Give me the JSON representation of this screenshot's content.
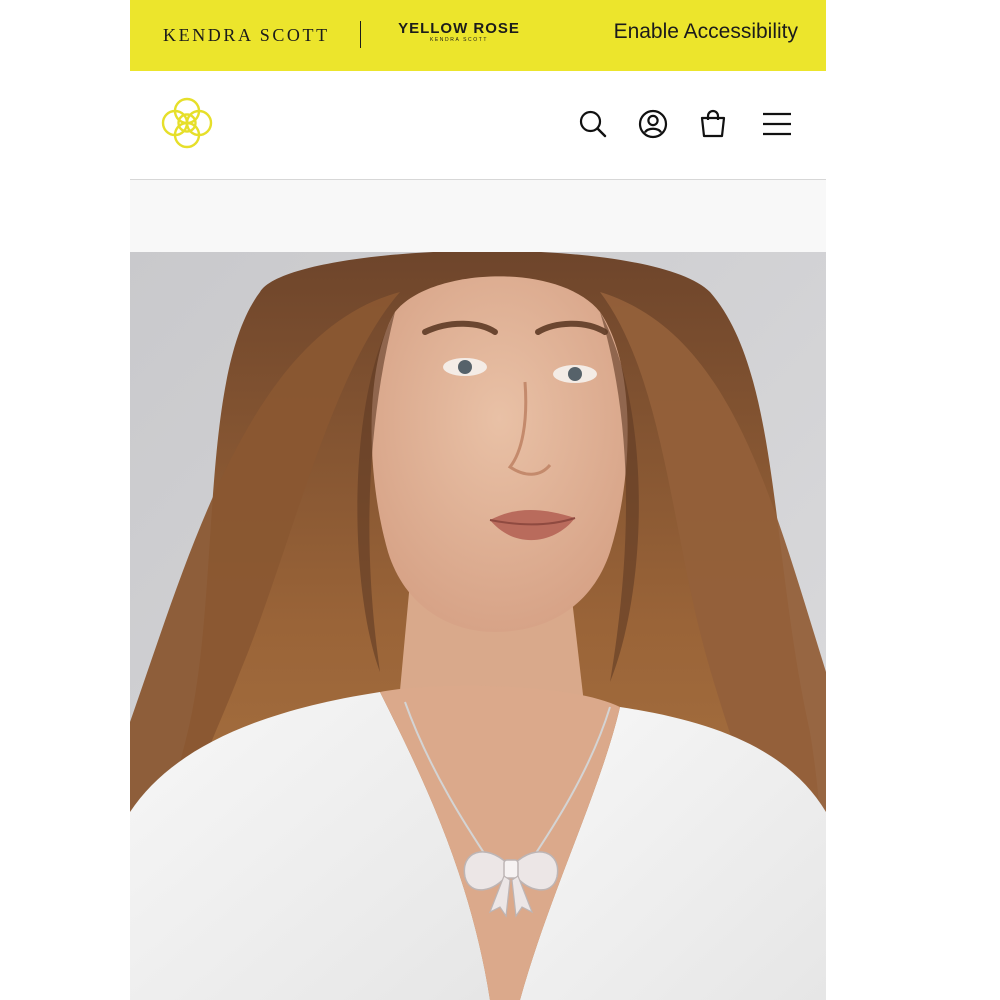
{
  "brand_bar": {
    "kendra_scott": "KENDRA SCOTT",
    "yellow_rose": "YELLOW ROSE",
    "yellow_rose_sub": "KENDRA SCOTT",
    "accessibility": "Enable Accessibility"
  },
  "header": {
    "logo": "kendra-scott-flower-logo",
    "icons": [
      "search-icon",
      "account-icon",
      "shopping-bag-icon",
      "hamburger-menu-icon"
    ]
  },
  "promo_strip": {},
  "hero": {
    "image": "model-wearing-bow-pendant-necklace"
  },
  "colors": {
    "brand_yellow": "#ece52c",
    "logo_yellow": "#e6df2a",
    "text_dark": "#1b1b1b",
    "divider": "#d7d7d7",
    "strip_bg": "#f8f8f8"
  }
}
